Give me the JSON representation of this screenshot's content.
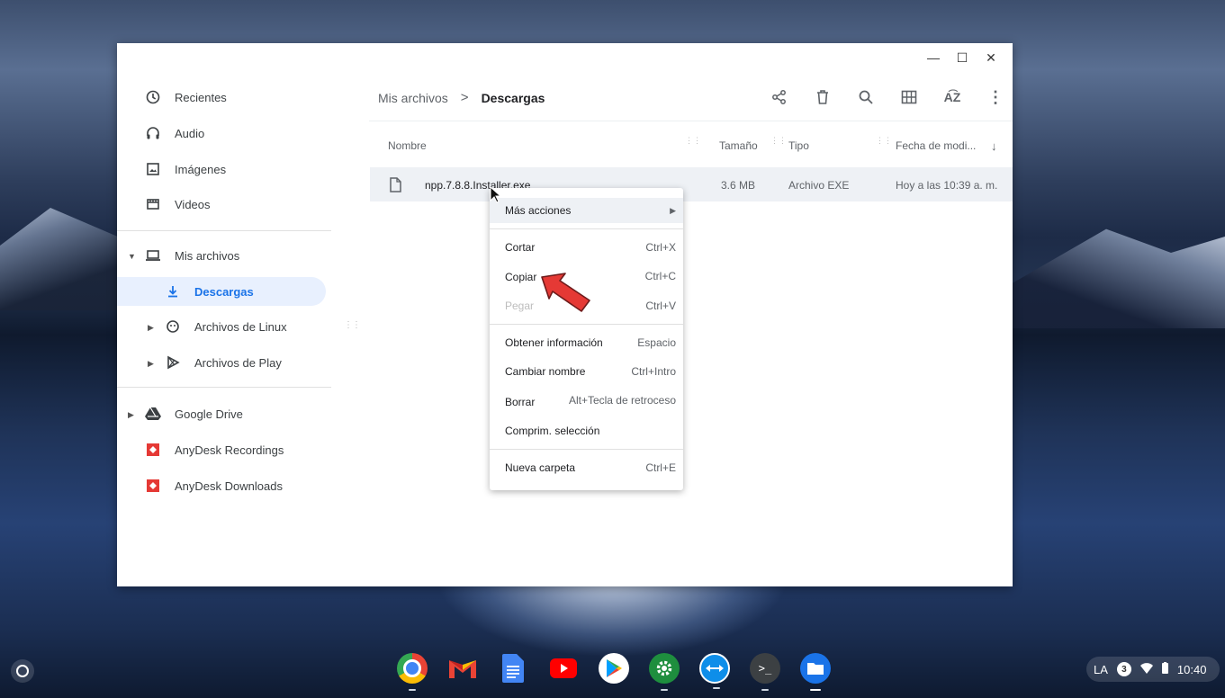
{
  "sidebar": {
    "items": [
      {
        "label": "Recientes",
        "icon": "clock-icon"
      },
      {
        "label": "Audio",
        "icon": "headphones-icon"
      },
      {
        "label": "Imágenes",
        "icon": "image-icon"
      },
      {
        "label": "Videos",
        "icon": "video-icon"
      },
      {
        "label": "Mis archivos",
        "icon": "laptop-icon"
      },
      {
        "label": "Descargas",
        "icon": "download-icon"
      },
      {
        "label": "Archivos de Linux",
        "icon": "linux-icon"
      },
      {
        "label": "Archivos de Play",
        "icon": "play-icon"
      },
      {
        "label": "Google Drive",
        "icon": "drive-icon"
      },
      {
        "label": "AnyDesk Recordings",
        "icon": "anydesk-icon"
      },
      {
        "label": "AnyDesk Downloads",
        "icon": "anydesk-icon"
      }
    ]
  },
  "breadcrumb": {
    "root": "Mis archivos",
    "separator": ">",
    "current": "Descargas"
  },
  "columns": {
    "name": "Nombre",
    "size": "Tamaño",
    "type": "Tipo",
    "date": "Fecha de modi..."
  },
  "file": {
    "name": "npp.7.8.8.Installer.exe",
    "size": "3.6 MB",
    "type": "Archivo EXE",
    "date": "Hoy a las 10:39 a. m."
  },
  "context_menu": [
    {
      "label": "Más acciones",
      "shortcut": "▶"
    },
    {
      "label": "Cortar",
      "shortcut": "Ctrl+X"
    },
    {
      "label": "Copiar",
      "shortcut": "Ctrl+C"
    },
    {
      "label": "Pegar",
      "shortcut": "Ctrl+V"
    },
    {
      "label": "Obtener información",
      "shortcut": "Espacio"
    },
    {
      "label": "Cambiar nombre",
      "shortcut": "Ctrl+Intro"
    },
    {
      "label": "Borrar",
      "shortcut": "Alt+Tecla de retroceso"
    },
    {
      "label": "Comprim. selección",
      "shortcut": ""
    },
    {
      "label": "Nueva carpeta",
      "shortcut": "Ctrl+E"
    }
  ],
  "tray": {
    "ime": "LA",
    "notifications": "3",
    "time": "10:40"
  },
  "colors": {
    "accent": "#1a73e8",
    "selected_bg": "#e8f0fe",
    "row_bg": "#eef1f5",
    "arrow": "#e53935"
  }
}
